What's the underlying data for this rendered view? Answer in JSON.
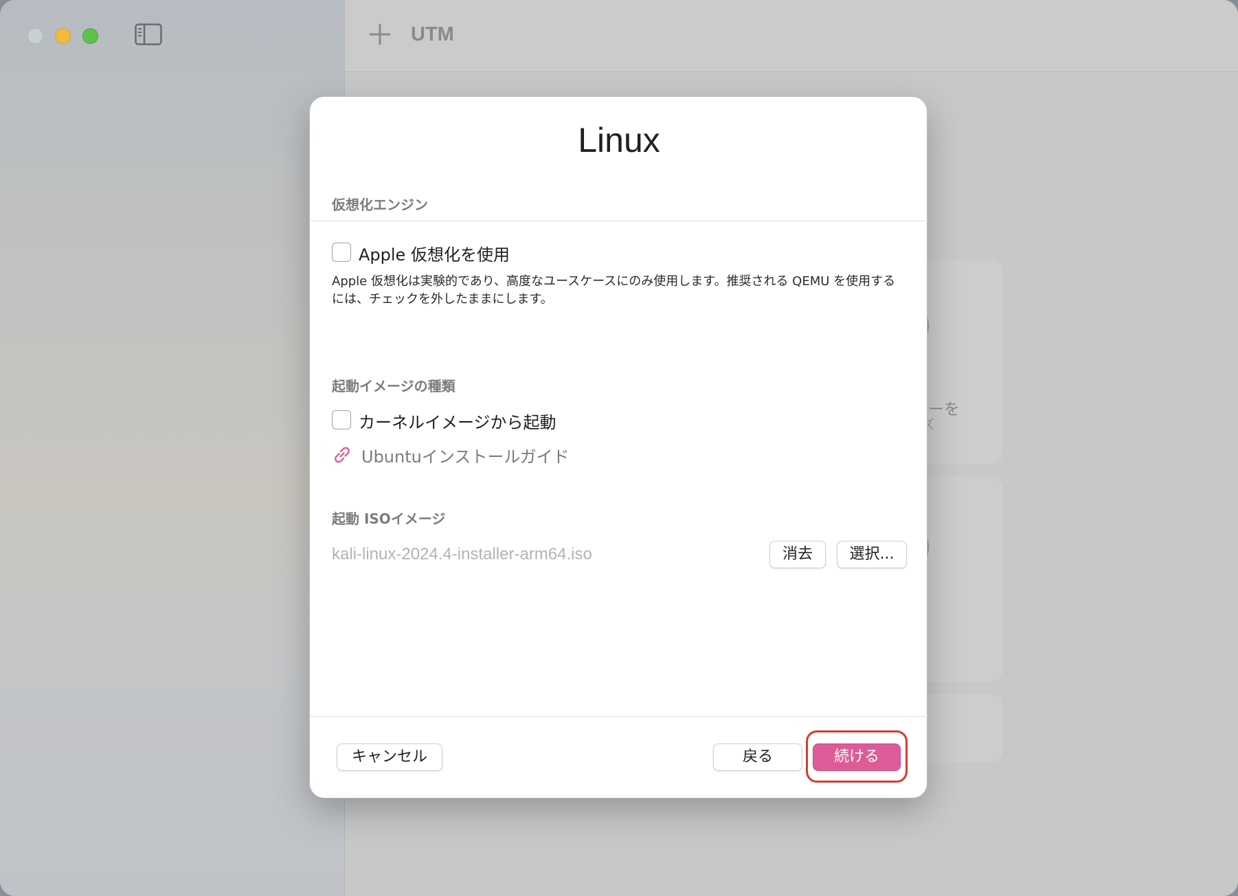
{
  "window": {
    "app_title": "UTM"
  },
  "background": {
    "card_text_line1": "リーを",
    "card_text_line2": "ズ"
  },
  "dialog": {
    "title": "Linux",
    "engine_section": {
      "label": "仮想化エンジン",
      "checkbox_label": "Apple 仮想化を使用",
      "checked": false,
      "description": "Apple 仮想化は実験的であり、高度なユースケースにのみ使用します。推奨される QEMU を使用するには、チェックを外したままにします。"
    },
    "boot_type_section": {
      "label": "起動イメージの種類",
      "checkbox_label": "カーネルイメージから起動",
      "checked": false,
      "link_label": "Ubuntuインストールガイド"
    },
    "iso_section": {
      "label": "起動 ISOイメージ",
      "file_value": "kali-linux-2024.4-installer-arm64.iso",
      "clear_label": "消去",
      "choose_label": "選択..."
    },
    "footer": {
      "cancel_label": "キャンセル",
      "back_label": "戻る",
      "continue_label": "続ける"
    }
  },
  "colors": {
    "accent": "#dd5c97",
    "highlight": "#d63b2f"
  },
  "icons": {
    "add": "plus-icon",
    "sidebar_toggle": "sidebar-toggle-icon",
    "link": "link-icon"
  }
}
